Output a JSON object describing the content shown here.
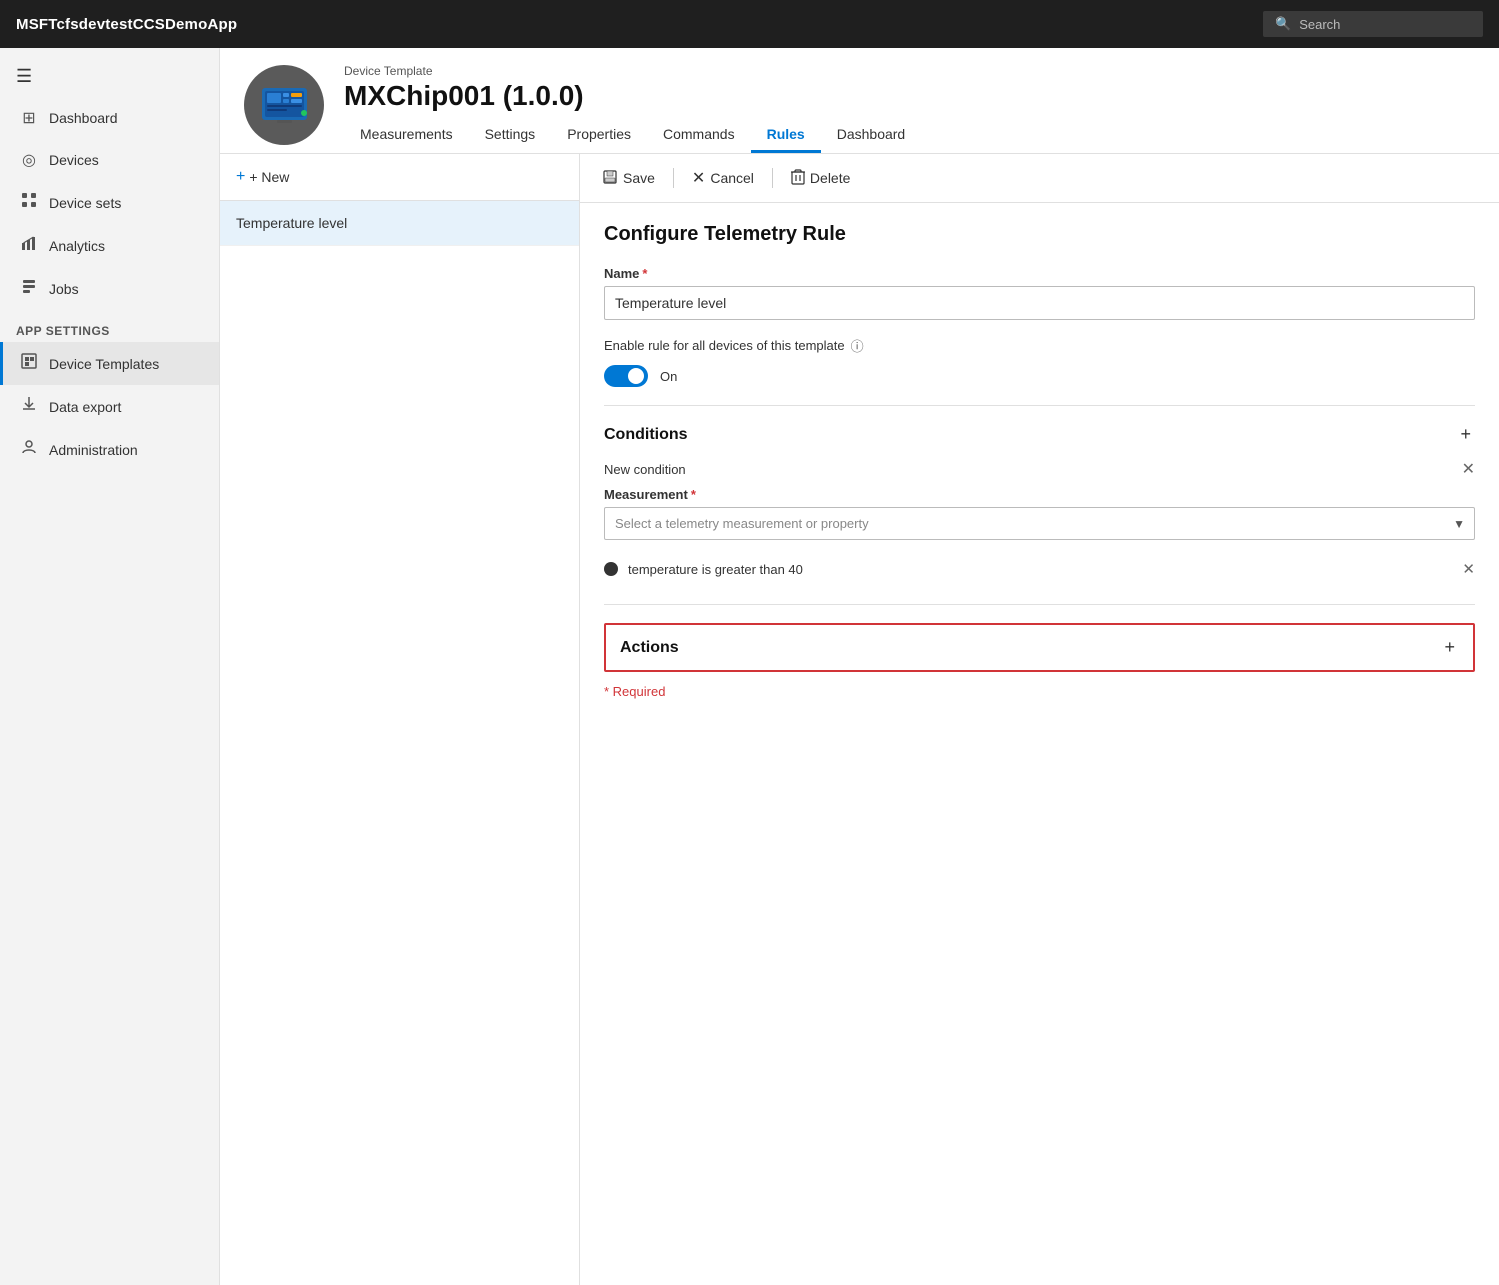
{
  "app": {
    "title": "MSFTcfsdevtestCCSDemoApp"
  },
  "topbar": {
    "search_placeholder": "Search"
  },
  "sidebar": {
    "hamburger_label": "☰",
    "items": [
      {
        "id": "dashboard",
        "label": "Dashboard",
        "icon": "⊞"
      },
      {
        "id": "devices",
        "label": "Devices",
        "icon": "◎"
      },
      {
        "id": "device-sets",
        "label": "Device sets",
        "icon": "⁙"
      },
      {
        "id": "analytics",
        "label": "Analytics",
        "icon": "📈"
      },
      {
        "id": "jobs",
        "label": "Jobs",
        "icon": "📋"
      }
    ],
    "app_settings_label": "App settings",
    "app_settings_items": [
      {
        "id": "device-templates",
        "label": "Device Templates",
        "icon": "◫"
      },
      {
        "id": "data-export",
        "label": "Data export",
        "icon": "⬡"
      },
      {
        "id": "administration",
        "label": "Administration",
        "icon": "👤"
      }
    ]
  },
  "device_template": {
    "label": "Device Template",
    "title": "MXChip001  (1.0.0)",
    "tabs": [
      {
        "id": "measurements",
        "label": "Measurements"
      },
      {
        "id": "settings",
        "label": "Settings"
      },
      {
        "id": "properties",
        "label": "Properties"
      },
      {
        "id": "commands",
        "label": "Commands"
      },
      {
        "id": "rules",
        "label": "Rules",
        "active": true
      },
      {
        "id": "dashboard",
        "label": "Dashboard"
      }
    ]
  },
  "left_panel": {
    "new_button": "+ New",
    "rules": [
      {
        "id": "temp-level",
        "label": "Temperature level",
        "active": true
      }
    ]
  },
  "right_panel": {
    "toolbar": {
      "save_label": "Save",
      "cancel_label": "Cancel",
      "delete_label": "Delete"
    },
    "form": {
      "section_title": "Configure Telemetry Rule",
      "name_label": "Name",
      "name_value": "Temperature level",
      "enable_rule_label": "Enable rule for all devices of this template",
      "toggle_on_label": "On",
      "conditions_title": "Conditions",
      "new_condition_label": "New condition",
      "measurement_label": "Measurement",
      "measurement_placeholder": "Select a telemetry measurement or property",
      "condition_text": "temperature is greater than 40",
      "actions_title": "Actions",
      "required_note": "* Required"
    }
  }
}
